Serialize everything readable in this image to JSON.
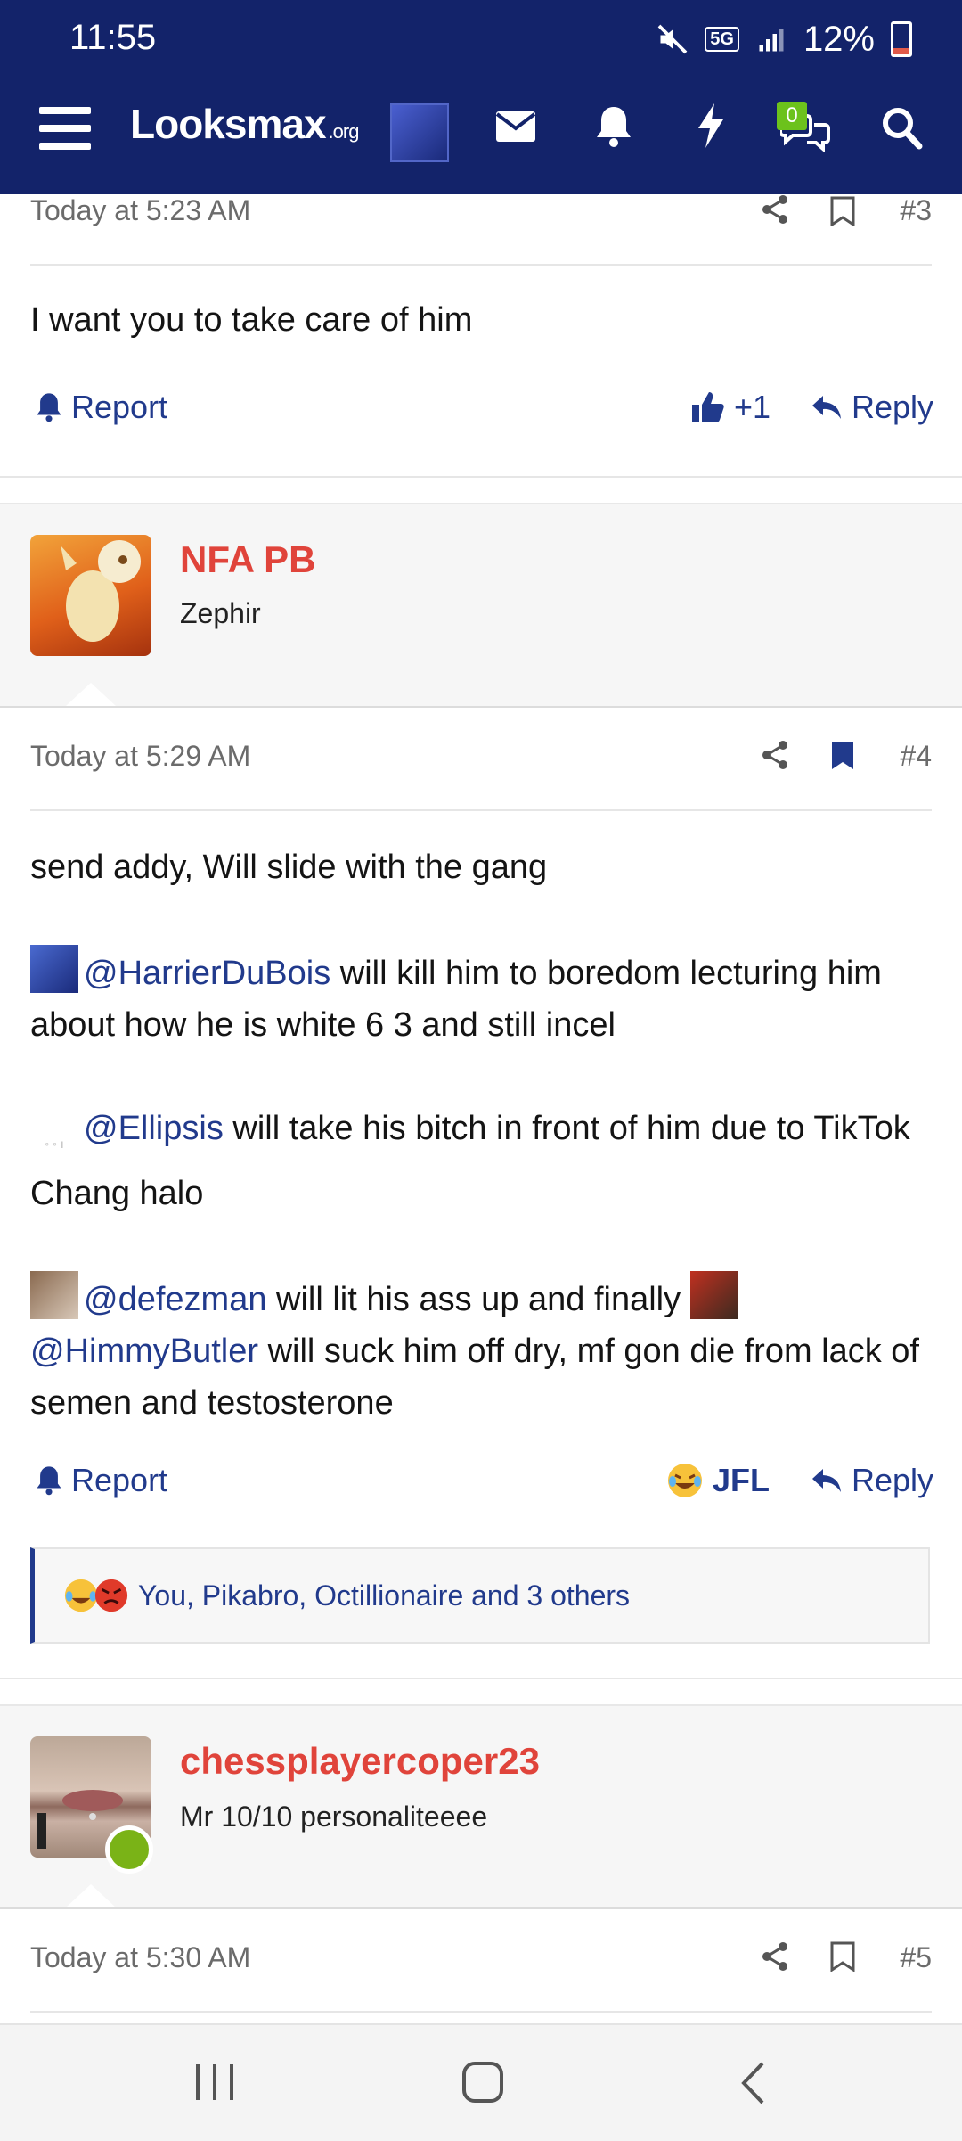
{
  "status_bar": {
    "time": "11:55",
    "network": "5G",
    "battery": "12%"
  },
  "nav": {
    "logo_main": "Looksmax",
    "logo_suffix": ".org",
    "chat_count": "0"
  },
  "post3": {
    "timestamp": "Today at 5:23 AM",
    "number": "#3",
    "body": "I want you to take care of him",
    "report_label": "Report",
    "reaction_label": "+1",
    "reply_label": "Reply"
  },
  "post4": {
    "username": "NFA PB",
    "user_title": "Zephir",
    "timestamp": "Today at 5:29 AM",
    "number": "#4",
    "lines": {
      "l1": "send addy, Will slide with the gang",
      "m1": "@HarrierDuBois",
      "t1": " will kill him to boredom lecturing him about how he is white 6 3 and still incel",
      "m2": "@Ellipsis",
      "t2": " will take his bitch in front of him due to TikTok Chang halo",
      "m3": "@defezman",
      "t3": " will lit his ass up and finally ",
      "m4": "@HimmyButler",
      "t4": " will suck him off dry, mf gon die from lack of semen and testosterone"
    },
    "report_label": "Report",
    "reaction_label": "JFL",
    "reply_label": "Reply",
    "reactions_summary": "You, Pikabro, Octillionaire and 3 others"
  },
  "post5": {
    "username": "chessplayercoper23",
    "user_title": "Mr 10/10 personaliteeee",
    "timestamp": "Today at 5:30 AM",
    "number": "#5"
  },
  "colors": {
    "navbar": "#13236a",
    "link": "#213a8c",
    "username": "#e0443b",
    "online": "#7ab317"
  }
}
